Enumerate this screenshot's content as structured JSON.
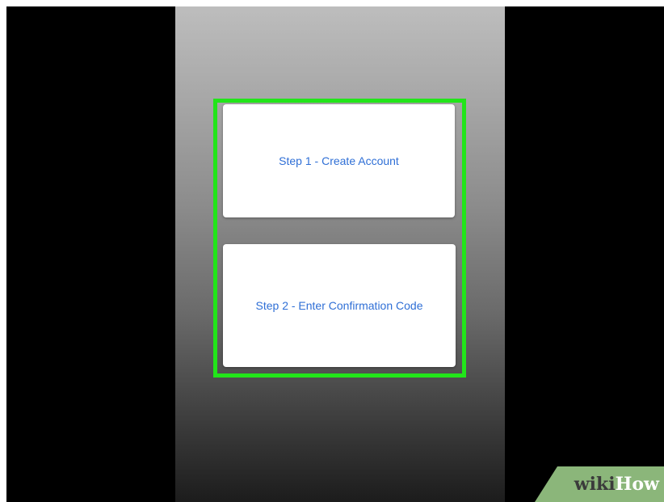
{
  "steps": {
    "step1_label": "Step 1 - Create Account",
    "step2_label": "Step 2 - Enter Confirmation Code"
  },
  "watermark": {
    "wiki": "wiki",
    "how": "How"
  },
  "colors": {
    "highlight": "#22e51a",
    "link_text": "#2f6fd6",
    "watermark_bg": "#8bb67a"
  }
}
